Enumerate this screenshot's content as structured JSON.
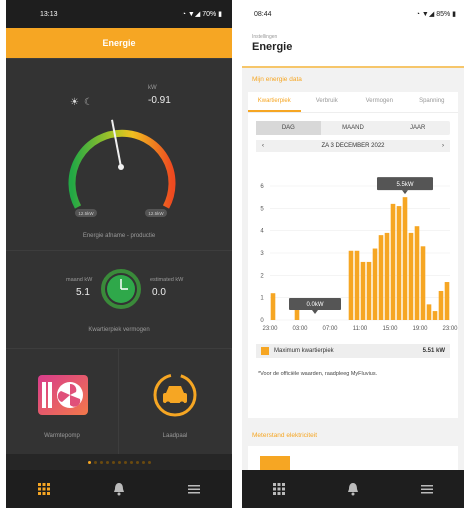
{
  "left": {
    "status": {
      "time": "13:13",
      "battery": "70%"
    },
    "header_title": "Energie",
    "gauge": {
      "unit": "kW",
      "value": "-0.91",
      "min_label": "12.5kW",
      "max_label": "12.5kW",
      "caption": "Energie afname - productie",
      "needle_fraction": 0.46
    },
    "peak": {
      "left_label": "maand kW",
      "left_value": "5.1",
      "right_label": "estimated kW",
      "right_value": "0.0",
      "caption": "Kwartierpiek vermogen"
    },
    "tiles": [
      {
        "label": "Warmtepomp"
      },
      {
        "label": "Laadpaal"
      }
    ],
    "nav_icons": [
      "grid-icon",
      "bell-icon",
      "menu-icon"
    ],
    "colors": {
      "accent": "#f6a623",
      "background": "#2b2b2b"
    }
  },
  "right": {
    "status": {
      "time": "08:44",
      "battery": "85%"
    },
    "breadcrumb": "Instellingen",
    "title": "Energie",
    "section_title": "Mijn energie data",
    "tabs": [
      "Kwartierpiek",
      "Verbruik",
      "Vermogen",
      "Spanning"
    ],
    "periods": [
      "DAG",
      "MAAND",
      "JAAR"
    ],
    "date": "ZA 3 DECEMBER 2022",
    "tooltip_max": "5.5kW",
    "tooltip_min": "0.0kW",
    "legend_label": "Maximum kwartierpiek",
    "legend_value": "5.51 kW",
    "note": "*Voor de officiële waarden, raadpleeg MyFluvius.",
    "meter_title": "Meterstand elektriciteit",
    "nav_icons": [
      "grid-icon",
      "bell-icon",
      "menu-icon"
    ]
  },
  "chart_data": {
    "type": "bar",
    "x_tick_labels": [
      "23:00",
      "03:00",
      "07:00",
      "11:00",
      "15:00",
      "19:00",
      "23:00"
    ],
    "values": [
      1.2,
      0,
      0,
      0,
      0.6,
      0,
      0,
      0,
      0,
      0,
      0,
      0,
      0,
      3.1,
      3.1,
      2.6,
      2.6,
      3.2,
      3.8,
      3.9,
      5.2,
      5.1,
      5.5,
      3.9,
      4.2,
      3.3,
      0.7,
      0.4,
      1.3,
      1.7
    ],
    "ylim": [
      0,
      6
    ],
    "y_ticks": [
      0,
      1,
      2,
      3,
      4,
      5,
      6
    ],
    "color": "#f6a623"
  }
}
